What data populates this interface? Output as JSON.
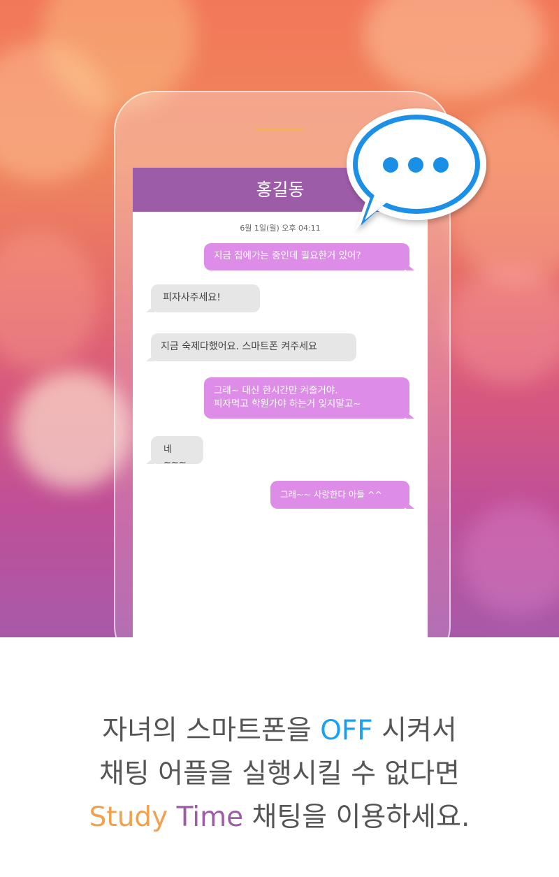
{
  "chat": {
    "contact_name": "홍길동",
    "date": "6월 1일(월) 오후 04:11",
    "messages": [
      {
        "side": "out",
        "text": "지금 집에가는 중인데 필요한거 있어?"
      },
      {
        "side": "in",
        "text": "피자사주세요!"
      },
      {
        "side": "in",
        "text": "지금 숙제다했어요. 스마트폰 켜주세요"
      },
      {
        "side": "out",
        "line1": "그래~ 대신 한시간만 켜줄거야.",
        "line2": "피자먹고 학원가야 하는거 잊지말고~"
      },
      {
        "side": "in",
        "text": "네~~~"
      },
      {
        "side": "out",
        "text": "그래~~ 사랑한다 아들 ^^"
      }
    ]
  },
  "chat_icon": "speech-bubble-typing-icon",
  "caption": {
    "line1_before": "자녀의 스마트폰을 ",
    "line1_highlight": "OFF",
    "line1_after": " 시켜서",
    "line2": "채팅 어플을 실행시킬 수 없다면",
    "line3_highlight_a": "Study",
    "line3_highlight_b": "Time",
    "line3_after": " 채팅을 이용하세요."
  },
  "colors": {
    "header": "#9d5ca7",
    "outgoing_bubble": "#dd8ce8",
    "incoming_bubble": "#e6e6e6",
    "accent_blue": "#1aa1f0",
    "accent_orange": "#f3a04c"
  }
}
